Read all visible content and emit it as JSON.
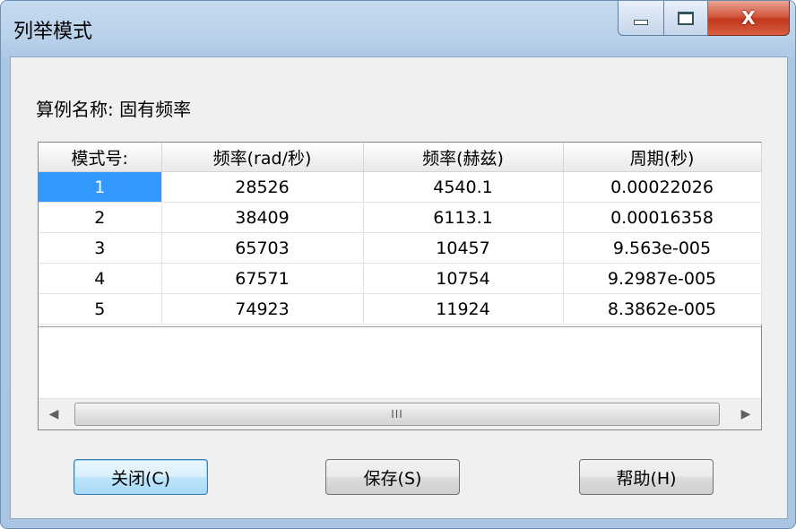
{
  "window": {
    "title": "列举模式",
    "close_glyph": "X"
  },
  "example": {
    "label": "算例名称: 固有频率"
  },
  "table": {
    "columns": [
      "模式号:",
      "频率(rad/秒)",
      "频率(赫兹)",
      "周期(秒)"
    ],
    "rows": [
      [
        "1",
        "28526",
        "4540.1",
        "0.00022026"
      ],
      [
        "2",
        "38409",
        "6113.1",
        "0.00016358"
      ],
      [
        "3",
        "65703",
        "10457",
        "9.563e-005"
      ],
      [
        "4",
        "67571",
        "10754",
        "9.2987e-005"
      ],
      [
        "5",
        "74923",
        "11924",
        "8.3862e-005"
      ]
    ],
    "selected_row": 0
  },
  "scrollbar": {
    "left_arrow": "◀",
    "right_arrow": "▶",
    "grip": "III"
  },
  "buttons": {
    "close": "关闭(C)",
    "save": "保存(S)",
    "help": "帮助(H)"
  },
  "colors": {
    "selection": "#3399ff",
    "title_bar": "#b9d1ea",
    "close_button": "#c2381c"
  }
}
